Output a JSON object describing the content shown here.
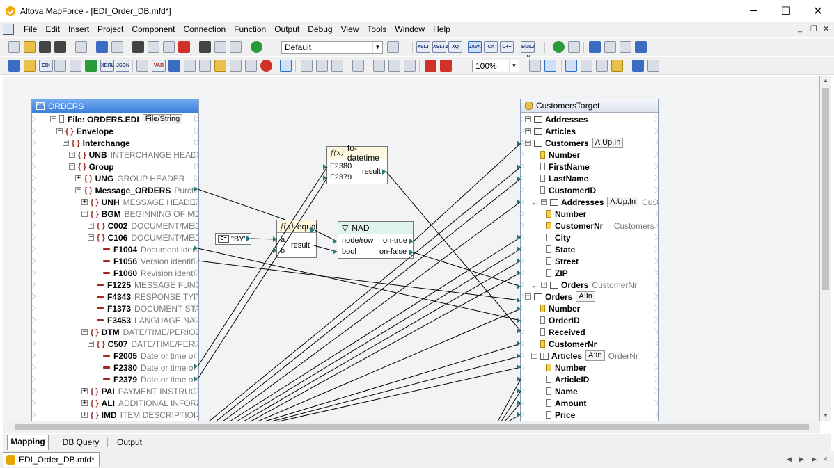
{
  "window": {
    "title": "Altova MapForce - [EDI_Order_DB.mfd*]",
    "minimize": "─",
    "maximize": "☐",
    "close": "✕"
  },
  "menu": [
    "File",
    "Edit",
    "Insert",
    "Project",
    "Component",
    "Connection",
    "Function",
    "Output",
    "Debug",
    "View",
    "Tools",
    "Window",
    "Help"
  ],
  "mdi": {
    "min": "_",
    "restore": "❐",
    "close": "✕"
  },
  "toolbar": {
    "config": "Default",
    "zoom": "100%",
    "lang": [
      "XSLT",
      "XSLT2",
      "XQ",
      "JAVA",
      "C#",
      "C++",
      "BUILT IN"
    ],
    "lib": [
      "EDI",
      "XBRL",
      "JSON",
      "VAR"
    ]
  },
  "source": {
    "title": "ORDERS",
    "rows": [
      {
        "text": "File: ORDERS.EDI",
        "tag": "File/String",
        "exp": "−",
        "indent": 0,
        "icon": "file"
      },
      {
        "text": "Envelope",
        "exp": "−",
        "indent": 1
      },
      {
        "text": "Interchange",
        "exp": "−",
        "indent": 2
      },
      {
        "text": "UNB",
        "desc": "INTERCHANGE HEADER",
        "exp": "+",
        "indent": 3
      },
      {
        "text": "Group",
        "exp": "−",
        "indent": 3
      },
      {
        "text": "UNG",
        "desc": "GROUP HEADER",
        "exp": "+",
        "indent": 4
      },
      {
        "text": "Message_ORDERS",
        "desc": "Purch",
        "exp": "−",
        "indent": 4
      },
      {
        "text": "UNH",
        "desc": "MESSAGE HEADER",
        "exp": "+",
        "indent": 5
      },
      {
        "text": "BGM",
        "desc": "BEGINNING OF MESS",
        "exp": "−",
        "indent": 5
      },
      {
        "text": "C002",
        "desc": "DOCUMENT/MESSA",
        "exp": "+",
        "indent": 6
      },
      {
        "text": "C106",
        "desc": "DOCUMENT/MESSA",
        "exp": "−",
        "indent": 6
      },
      {
        "text": "F1004",
        "desc": "Document identi",
        "indent": 7,
        "icon": "field"
      },
      {
        "text": "F1056",
        "desc": "Version identifi",
        "indent": 7,
        "icon": "field"
      },
      {
        "text": "F1060",
        "desc": "Revision identifi",
        "indent": 7,
        "icon": "field"
      },
      {
        "text": "F1225",
        "desc": "MESSAGE FUNCTIO",
        "indent": 6,
        "icon": "field"
      },
      {
        "text": "F4343",
        "desc": "RESPONSE TYPE CC",
        "indent": 6,
        "icon": "field"
      },
      {
        "text": "F1373",
        "desc": "DOCUMENT STATUS",
        "indent": 6,
        "icon": "field"
      },
      {
        "text": "F3453",
        "desc": "LANGUAGE NAME",
        "indent": 6,
        "icon": "field"
      },
      {
        "text": "DTM",
        "desc": "DATE/TIME/PERIOD",
        "exp": "−",
        "indent": 5
      },
      {
        "text": "C507",
        "desc": "DATE/TIME/PERIOD",
        "exp": "−",
        "indent": 6
      },
      {
        "text": "F2005",
        "desc": "Date or time or p",
        "indent": 7,
        "icon": "field"
      },
      {
        "text": "F2380",
        "desc": "Date or time or p",
        "indent": 7,
        "icon": "field"
      },
      {
        "text": "F2379",
        "desc": "Date or time or p",
        "indent": 7,
        "icon": "field"
      },
      {
        "text": "PAI",
        "desc": "PAYMENT INSTRUCTION",
        "exp": "+",
        "indent": 5
      },
      {
        "text": "ALI",
        "desc": "ADDITIONAL INFORMAT",
        "exp": "+",
        "indent": 5
      },
      {
        "text": "IMD",
        "desc": "ITEM DESCRIPTION",
        "exp": "+",
        "indent": 5
      }
    ]
  },
  "target": {
    "title": "CustomersTarget",
    "rows": [
      {
        "text": "Addresses",
        "exp": "+",
        "indent": 0,
        "icon": "table"
      },
      {
        "text": "Articles",
        "exp": "+",
        "indent": 0,
        "icon": "table"
      },
      {
        "text": "Customers",
        "tag": "A:Up,In",
        "exp": "−",
        "indent": 0,
        "icon": "table"
      },
      {
        "text": "Number",
        "indent": 1,
        "icon": "key"
      },
      {
        "text": "FirstName",
        "indent": 1,
        "icon": "col"
      },
      {
        "text": "LastName",
        "indent": 1,
        "icon": "col"
      },
      {
        "text": "CustomerID",
        "indent": 1,
        "icon": "col"
      },
      {
        "text": "Addresses",
        "tag": "A:Up,In",
        "desc": "Custon",
        "exp": "−",
        "indent": 1,
        "icon": "table",
        "rel": "←"
      },
      {
        "text": "Number",
        "indent": 2,
        "icon": "key"
      },
      {
        "text": "CustomerNr",
        "desc": "= Customers",
        "indent": 2,
        "icon": "key"
      },
      {
        "text": "City",
        "indent": 2,
        "icon": "col"
      },
      {
        "text": "State",
        "indent": 2,
        "icon": "col"
      },
      {
        "text": "Street",
        "indent": 2,
        "icon": "col"
      },
      {
        "text": "ZIP",
        "indent": 2,
        "icon": "col"
      },
      {
        "text": "Orders",
        "desc": "CustomerNr",
        "exp": "+",
        "indent": 1,
        "icon": "table",
        "rel": "←"
      },
      {
        "text": "Orders",
        "tag": "A:In",
        "exp": "−",
        "indent": 0,
        "icon": "table"
      },
      {
        "text": "Number",
        "indent": 1,
        "icon": "key"
      },
      {
        "text": "OrderID",
        "indent": 1,
        "icon": "col"
      },
      {
        "text": "Received",
        "indent": 1,
        "icon": "col"
      },
      {
        "text": "CustomerNr",
        "indent": 1,
        "icon": "key"
      },
      {
        "text": "Articles",
        "tag": "A:In",
        "desc": "OrderNr",
        "exp": "−",
        "indent": 1,
        "icon": "table"
      },
      {
        "text": "Number",
        "indent": 2,
        "icon": "key"
      },
      {
        "text": "ArticleID",
        "indent": 2,
        "icon": "col"
      },
      {
        "text": "Name",
        "indent": 2,
        "icon": "col"
      },
      {
        "text": "Amount",
        "indent": 2,
        "icon": "col"
      },
      {
        "text": "Price",
        "indent": 2,
        "icon": "col"
      }
    ]
  },
  "functions": {
    "todatetime": {
      "name": "to-datetime",
      "fx": "f(x)",
      "in": [
        "F2380",
        "F2379"
      ],
      "out": "result"
    },
    "equal": {
      "name": "equal",
      "fx": "f(x)",
      "in": [
        "a",
        "b"
      ],
      "out": "result"
    },
    "nad": {
      "name": "NAD",
      "in": [
        "node/row",
        "bool"
      ],
      "out": [
        "on-true",
        "on-false"
      ]
    },
    "const": {
      "value": "\"BY\"",
      "icon": "C="
    }
  },
  "tabs": [
    "Mapping",
    "DB Query",
    "Output"
  ],
  "doc_tab": "EDI_Order_DB.mfd*",
  "colors": {
    "source_header": "#3d7fdc",
    "link": "#000000",
    "connector": "#237a7a"
  }
}
